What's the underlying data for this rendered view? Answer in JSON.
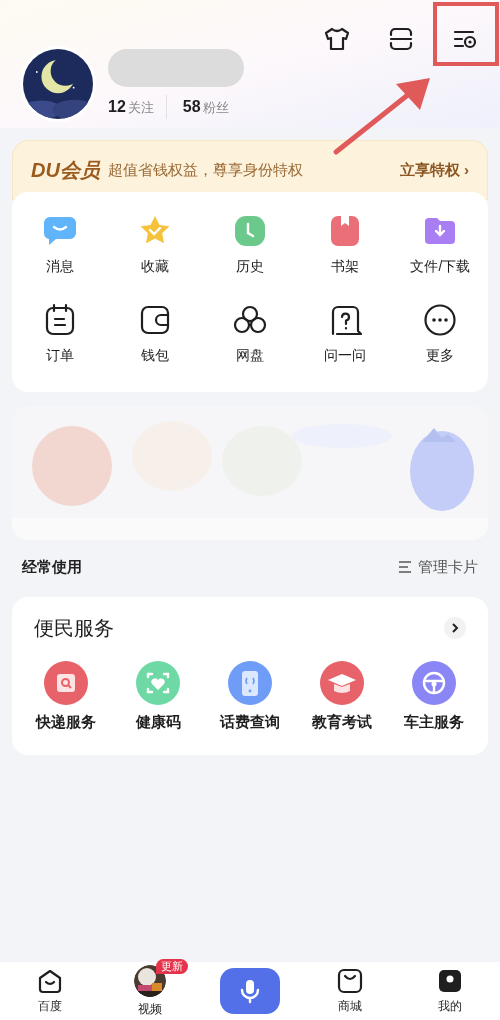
{
  "header": {
    "stats": [
      {
        "count": "12",
        "label": "关注"
      },
      {
        "count": "58",
        "label": "粉丝"
      }
    ]
  },
  "member_banner": {
    "brand": "DU会员",
    "text": "超值省钱权益，尊享身份特权",
    "action": "立享特权 ›"
  },
  "shortcuts": [
    {
      "kind": "message",
      "label": "消息"
    },
    {
      "kind": "star",
      "label": "收藏"
    },
    {
      "kind": "clock",
      "label": "历史"
    },
    {
      "kind": "book",
      "label": "书架"
    },
    {
      "kind": "download",
      "label": "文件/下载"
    },
    {
      "kind": "order",
      "label": "订单"
    },
    {
      "kind": "wallet",
      "label": "钱包"
    },
    {
      "kind": "cloud",
      "label": "网盘"
    },
    {
      "kind": "question",
      "label": "问一问"
    },
    {
      "kind": "more",
      "label": "更多"
    }
  ],
  "frequent": {
    "title": "经常使用",
    "manage": "管理卡片"
  },
  "services": {
    "title": "便民服务",
    "items": [
      {
        "kind": "express",
        "label": "快递服务",
        "color": "#e8626a"
      },
      {
        "kind": "health",
        "label": "健康码",
        "color": "#6fd9a6"
      },
      {
        "kind": "phone",
        "label": "话费查询",
        "color": "#6f9cf7"
      },
      {
        "kind": "education",
        "label": "教育考试",
        "color": "#e8626a"
      },
      {
        "kind": "car",
        "label": "车主服务",
        "color": "#8a86f5"
      }
    ]
  },
  "tab_bar": [
    {
      "kind": "home",
      "label": "百度"
    },
    {
      "kind": "video",
      "label": "视频",
      "badge": "更新"
    },
    {
      "kind": "voice"
    },
    {
      "kind": "shop",
      "label": "商城"
    },
    {
      "kind": "me",
      "label": "我的"
    }
  ]
}
